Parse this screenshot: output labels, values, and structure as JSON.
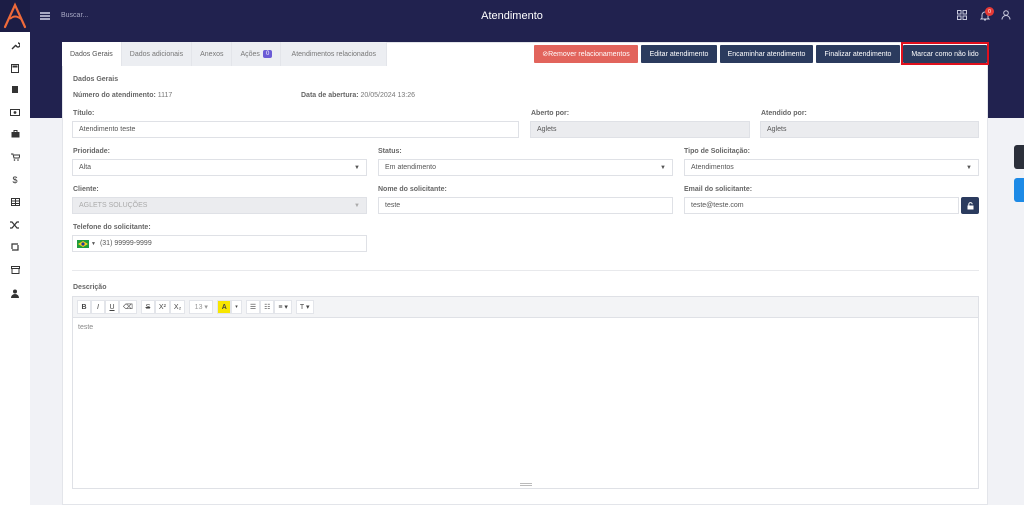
{
  "header": {
    "search_placeholder": "Buscar...",
    "title": "Atendimento",
    "notification_count": "0"
  },
  "tabs": [
    {
      "label": "Dados Gerais"
    },
    {
      "label": "Dados adicionais"
    },
    {
      "label": "Anexos"
    },
    {
      "label": "Ações",
      "badge": "0"
    },
    {
      "label": "Atendimentos relacionados"
    }
  ],
  "actions": {
    "remove_relations": "⊘Remover relacionamentos",
    "edit": "Editar atendimento",
    "forward": "Encaminhar atendimento",
    "finish": "Finalizar atendimento",
    "mark_unread": "Marcar como não lido"
  },
  "section_title": "Dados Gerais",
  "summary": {
    "number_label": "Número do atendimento:",
    "number_value": "1117",
    "opened_label": "Data de abertura:",
    "opened_value": "20/05/2024 13:26"
  },
  "fields": {
    "titulo": {
      "label": "Título:",
      "value": "Atendimento teste"
    },
    "aberto_por": {
      "label": "Aberto por:",
      "value": "Aglets"
    },
    "atendido_por": {
      "label": "Atendido por:",
      "value": "Aglets"
    },
    "prioridade": {
      "label": "Prioridade:",
      "value": "Alta"
    },
    "status": {
      "label": "Status:",
      "value": "Em atendimento"
    },
    "tipo": {
      "label": "Tipo de Solicitação:",
      "value": "Atendimentos"
    },
    "cliente": {
      "label": "Cliente:",
      "value": "AGLETS SOLUÇÕES"
    },
    "nome_solicitante": {
      "label": "Nome do solicitante:",
      "value": "teste"
    },
    "email_solicitante": {
      "label": "Email do solicitante:",
      "value": "teste@teste.com"
    },
    "telefone": {
      "label": "Telefone do solicitante:",
      "value": "(31) 99999-9999"
    }
  },
  "descricao": {
    "label": "Descrição",
    "content": "teste",
    "toolbar": {
      "bold": "B",
      "italic": "I",
      "underline": "U",
      "eraser": "⌫",
      "strike": "S",
      "superscript": "X²",
      "subscript": "X₂",
      "font_size": "13 ▾",
      "color": "A",
      "color_caret": "▾",
      "ul": "☰",
      "ol": "☷",
      "align": "≡ ▾",
      "style": "T ▾"
    }
  },
  "colors": {
    "navy": "#21224f",
    "button_navy": "#2b3b5e",
    "button_red": "#e2645c",
    "badge_purple": "#6b5bd6",
    "highlight": "#e0101d",
    "logo_orange": "#ef6a3a"
  }
}
